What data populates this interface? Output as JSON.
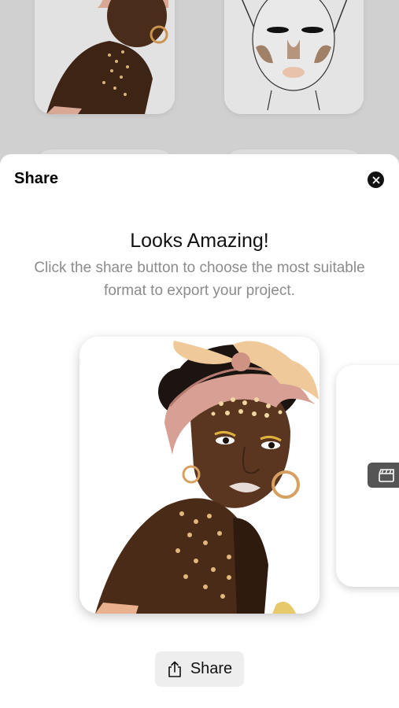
{
  "sheet": {
    "title": "Share",
    "heading": "Looks Amazing!",
    "description": "Click the share button to choose the most suitable format to export your project.",
    "share_button_label": "Share"
  },
  "icons": {
    "close": "close-icon",
    "share": "share-icon",
    "video_badge": "clapperboard-icon"
  },
  "colors": {
    "sheet_background": "#ffffff",
    "backdrop": "#d2d2d2",
    "share_button_bg": "#eeeeee",
    "subtext": "#8c8c8c"
  }
}
